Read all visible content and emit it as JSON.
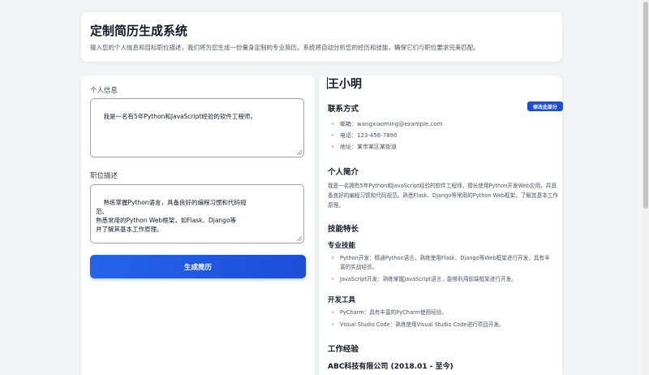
{
  "header": {
    "title": "定制简历生成系统",
    "subtitle": "输入您的个人信息和目标职位描述，我们将为您生成一份量身定制的专业简历。系统将自动分析您的经历和技能，确保它们与职位要求完美匹配。"
  },
  "form": {
    "personal_label": "个人信息",
    "personal_value": "我是一名有5年Python和JavaScript经验的软件工程师。",
    "job_label": "职位描述",
    "job_value": "熟练掌握Python语言，具备良好的编程习惯和代码规\n范。\n熟悉常用的Python Web框架，如Flask、Django等\n并了解其基本工作原理。",
    "generate_label": "生成简历"
  },
  "resume": {
    "name": "王小明",
    "contact_title": "联系方式",
    "edit_label": "修改此部分",
    "contact": [
      "邮箱：wangxiaoming@example.com",
      "电话：123-456-7890",
      "地址：某市某区某街道"
    ],
    "summary_title": "个人简介",
    "summary": "我是一名拥有5年Python和JavaScript经验的软件工程师，擅长使用Python开发Web应用，并具备良好的编程习惯和代码规范。熟悉Flask、Django等常用的Python Web框架，了解其基本工作原理。",
    "skills_title": "技能特长",
    "pro_skills_title": "专业技能",
    "pro_skills": [
      "Python开发：精通Python语言，熟练使用Flask、Django等Web框架进行开发，具有丰富的实战经验。",
      "JavaScript开发：熟练掌握JavaScript语言，能够利用前端框架进行开发。"
    ],
    "tools_title": "开发工具",
    "tools": [
      "PyCharm：具有丰富的PyCharm使用经验。",
      "Visual Studio Code：熟练使用Visual Studio Code进行项目开发。"
    ],
    "experience_title": "工作经验",
    "company": "ABC科技有限公司 (2018.01 - 至今)"
  },
  "colors": {
    "accent": "#2563eb",
    "background": "#f3f4f6"
  }
}
